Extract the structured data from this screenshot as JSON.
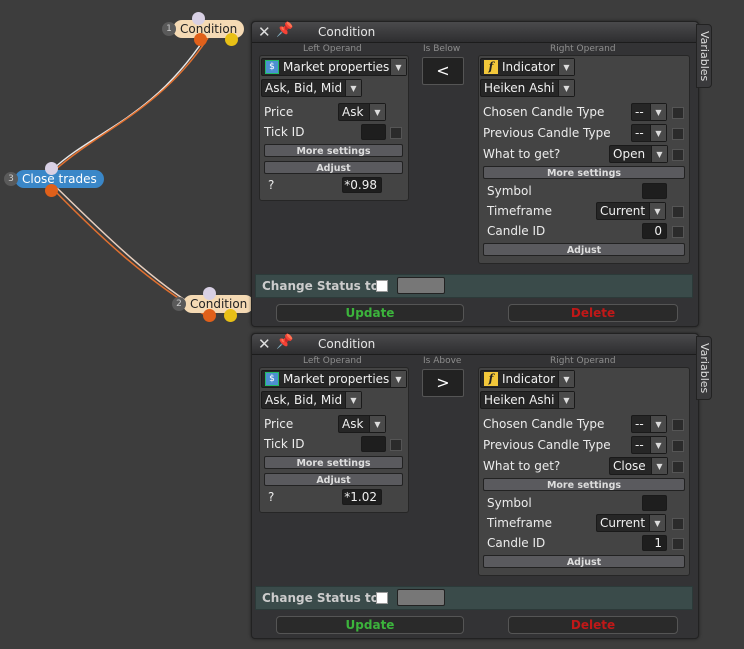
{
  "nodes": {
    "cond1": {
      "num": "1",
      "label": "Condition"
    },
    "close": {
      "num": "3",
      "label": "Close trades"
    },
    "cond2": {
      "num": "2",
      "label": "Condition"
    }
  },
  "panels": [
    {
      "title": "Condition",
      "variables_tab": "Variables",
      "left_header": "Left Operand",
      "op_header": "Is Below",
      "right_header": "Right Operand",
      "operator": "<",
      "left": {
        "source": "Market properties",
        "property": "Ask, Bid, Mid",
        "price_label": "Price",
        "price_value": "Ask",
        "tickid_label": "Tick ID",
        "more_settings": "More settings",
        "adjust": "Adjust",
        "adjust_label": "?",
        "adjust_value": "*0.98"
      },
      "right": {
        "source": "Indicator",
        "indicator": "Heiken Ashi",
        "rows": [
          {
            "label": "Chosen Candle Type",
            "value": "--"
          },
          {
            "label": "Previous Candle Type",
            "value": "--"
          },
          {
            "label": "What to get?",
            "value": "Open"
          }
        ],
        "more_settings": "More settings",
        "symbol_label": "Symbol",
        "timeframe_label": "Timeframe",
        "timeframe_value": "Current",
        "candle_label": "Candle ID",
        "candle_value": "0",
        "adjust": "Adjust"
      },
      "status_label": "Change Status to",
      "update": "Update",
      "delete": "Delete"
    },
    {
      "title": "Condition",
      "variables_tab": "Variables",
      "left_header": "Left Operand",
      "op_header": "Is Above",
      "right_header": "Right Operand",
      "operator": ">",
      "left": {
        "source": "Market properties",
        "property": "Ask, Bid, Mid",
        "price_label": "Price",
        "price_value": "Ask",
        "tickid_label": "Tick ID",
        "more_settings": "More settings",
        "adjust": "Adjust",
        "adjust_label": "?",
        "adjust_value": "*1.02"
      },
      "right": {
        "source": "Indicator",
        "indicator": "Heiken Ashi",
        "rows": [
          {
            "label": "Chosen Candle Type",
            "value": "--"
          },
          {
            "label": "Previous Candle Type",
            "value": "--"
          },
          {
            "label": "What to get?",
            "value": "Close"
          }
        ],
        "more_settings": "More settings",
        "symbol_label": "Symbol",
        "timeframe_label": "Timeframe",
        "timeframe_value": "Current",
        "candle_label": "Candle ID",
        "candle_value": "1",
        "adjust": "Adjust"
      },
      "status_label": "Change Status to",
      "update": "Update",
      "delete": "Delete"
    }
  ]
}
